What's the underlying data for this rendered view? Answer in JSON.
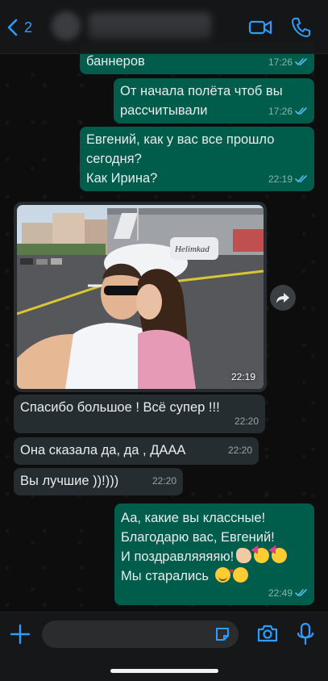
{
  "header": {
    "back_count": "2",
    "contact_name": "",
    "accent": "#2f9cff"
  },
  "messages": [
    {
      "dir": "out",
      "text": "баннеров",
      "time": "17:26",
      "status": "read"
    },
    {
      "dir": "out",
      "text": "От начала полёта чтоб вы\nрассчитывали",
      "time": "17:26",
      "status": "read"
    },
    {
      "dir": "out",
      "text": "Евгений, как у вас все прошло\nсегодня?\nКак Ирина?",
      "time": "22:19",
      "status": "read"
    },
    {
      "dir": "in",
      "type": "image",
      "time": "22:19"
    },
    {
      "dir": "in",
      "text": "Спасибо большое ! Всё супер !!!",
      "time": "22:20"
    },
    {
      "dir": "in",
      "text": "Она сказала да, да , ДААА",
      "time": "22:20"
    },
    {
      "dir": "in",
      "text": "Вы лучшие ))!)))",
      "time": "22:20"
    },
    {
      "dir": "out",
      "lines": [
        "Аа, какие вы классные!",
        "Благодарю вас, Евгений!",
        "И поздравляяяяю!",
        "Мы старались"
      ],
      "time": "22:49",
      "status": "read"
    }
  ],
  "photo_sign": "Helimkad",
  "icons": {
    "back": "chevron-left-icon",
    "video": "video-camera-icon",
    "call": "phone-icon",
    "forward": "forward-arrow-icon",
    "attach": "plus-icon",
    "sticker": "sticker-icon",
    "camera": "camera-icon",
    "mic": "microphone-icon"
  },
  "colors": {
    "outgoing_bubble": "#005c4b",
    "incoming_bubble": "#262d31",
    "read_ticks": "#53bdeb"
  }
}
